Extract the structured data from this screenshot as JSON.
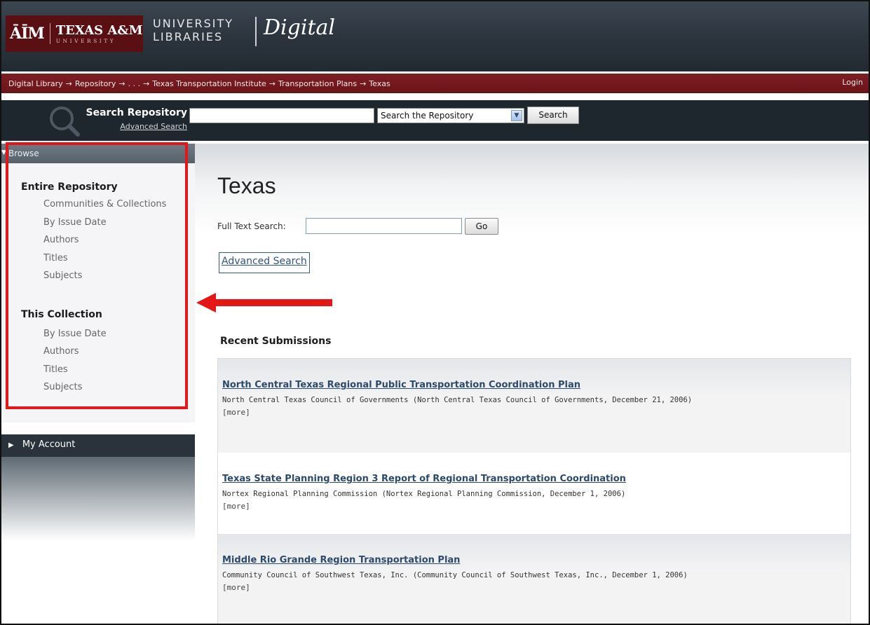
{
  "header": {
    "logo_atm": "ĀĪM",
    "logo_texas": "TEXAS A&M",
    "logo_university": "UNIVERSITY",
    "libraries_line1": "UNIVERSITY",
    "libraries_line2": "LIBRARIES",
    "digital": "Digital"
  },
  "breadcrumb": {
    "items": [
      "Digital Library",
      "Repository",
      ". . .",
      "Texas Transportation Institute",
      "Transportation Plans",
      "Texas"
    ],
    "arrow": "→",
    "login": "Login"
  },
  "search": {
    "title": "Search Repository",
    "advanced": "Advanced Search",
    "input_value": "",
    "scope_selected": "Search the Repository",
    "button": "Search"
  },
  "sidebar": {
    "browse_label": "Browse",
    "entire_title": "Entire Repository",
    "entire_links": [
      "Communities & Collections",
      "By Issue Date",
      "Authors",
      "Titles",
      "Subjects"
    ],
    "collection_title": "This Collection",
    "collection_links": [
      "By Issue Date",
      "Authors",
      "Titles",
      "Subjects"
    ],
    "account_label": "My Account"
  },
  "main": {
    "title": "Texas",
    "fulltext_label": "Full Text Search:",
    "fulltext_value": "",
    "go_button": "Go",
    "advanced_search": "Advanced Search",
    "recent_heading": "Recent Submissions",
    "items": [
      {
        "title": "North Central Texas Regional Public Transportation Coordination Plan",
        "meta": "North Central Texas Council of Governments (North Central Texas Council of Governments, December 21, 2006)",
        "more": "[more]"
      },
      {
        "title": "Texas State Planning Region 3 Report of Regional Transportation Coordination",
        "meta": "Nortex Regional Planning Commission (Nortex Regional Planning Commission, December 1, 2006)",
        "more": "[more]"
      },
      {
        "title": "Middle Rio Grande Region Transportation Plan",
        "meta": "Community Council of Southwest Texas, Inc. (Community Council of Southwest Texas, Inc., December 1, 2006)",
        "more": "[more]"
      }
    ]
  },
  "colors": {
    "maroon": "#6a1419",
    "annotation_red": "#e41616",
    "link_blue": "#2c4a6e"
  }
}
